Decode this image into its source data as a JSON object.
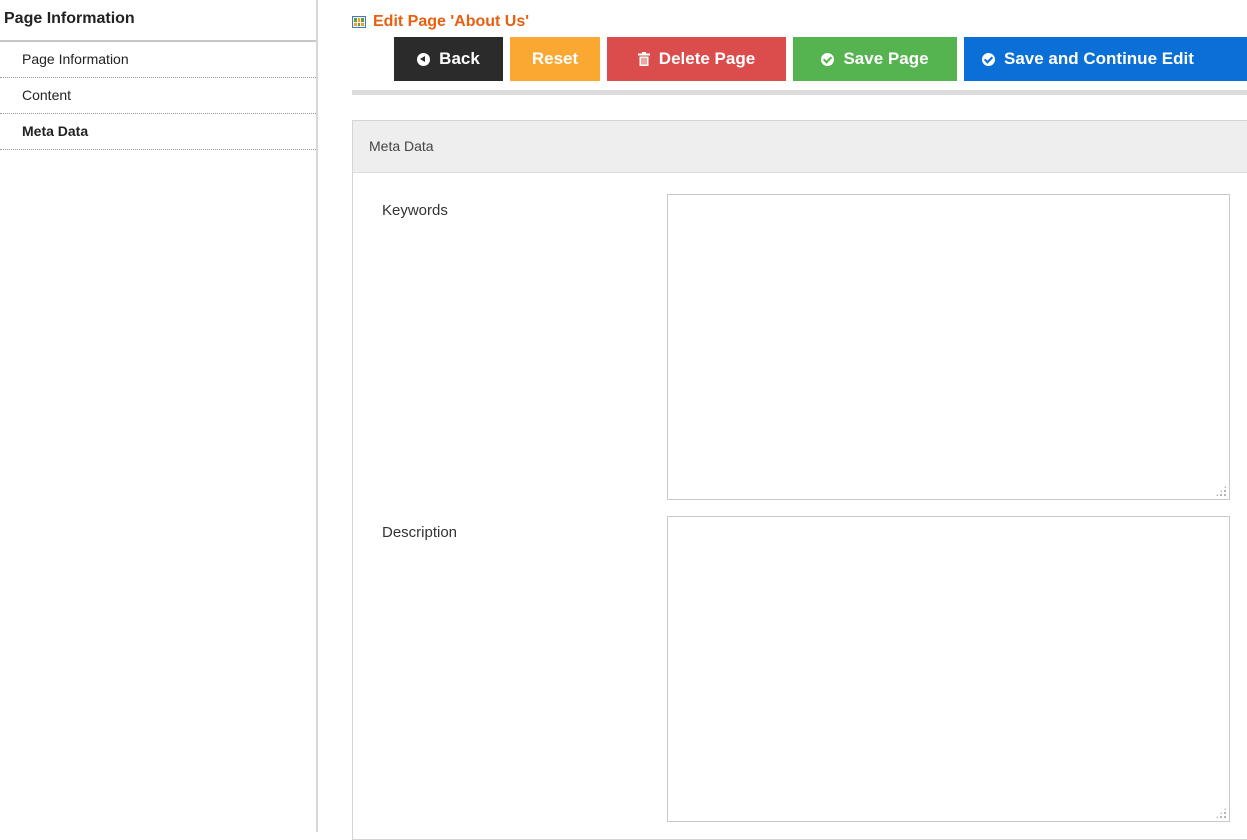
{
  "sidebar": {
    "title": "Page Information",
    "items": [
      {
        "label": "Page Information",
        "active": false
      },
      {
        "label": "Content",
        "active": false
      },
      {
        "label": "Meta Data",
        "active": true
      }
    ]
  },
  "header": {
    "title": "Edit Page 'About Us'",
    "icon": "table-icon"
  },
  "toolbar": {
    "back_label": "Back",
    "reset_label": "Reset",
    "delete_label": "Delete Page",
    "save_label": "Save Page",
    "save_continue_label": "Save and Continue Edit"
  },
  "colors": {
    "title": "#e8600f",
    "back": "#2b2b2b",
    "reset": "#faa832",
    "delete": "#db4c4c",
    "save": "#55b350",
    "save_continue": "#0a6fd6"
  },
  "panel": {
    "title": "Meta Data",
    "fields": {
      "keywords": {
        "label": "Keywords",
        "value": ""
      },
      "description": {
        "label": "Description",
        "value": ""
      }
    }
  }
}
